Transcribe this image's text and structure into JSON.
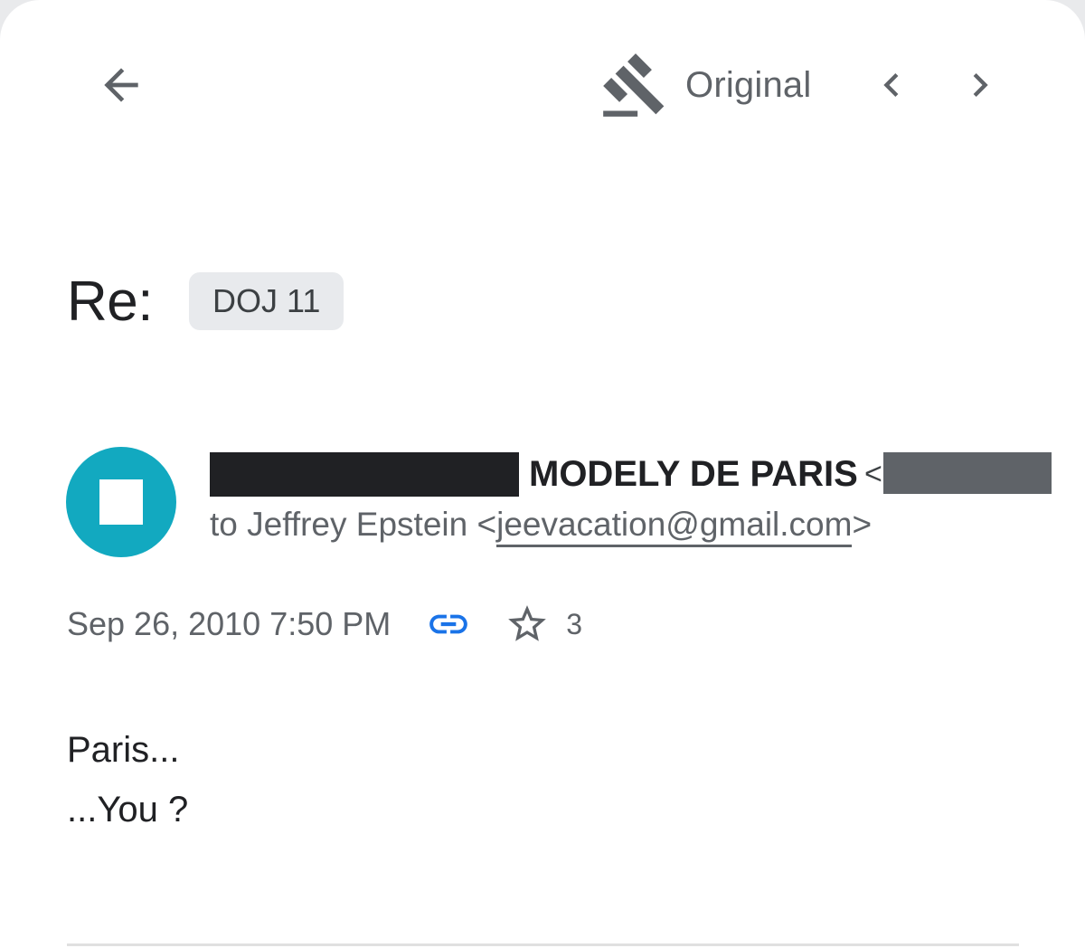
{
  "toolbar": {
    "back_icon": "arrow-back-icon",
    "original_icon": "gavel-icon",
    "original_label": "Original",
    "prev_icon": "chevron-left-icon",
    "next_icon": "chevron-right-icon"
  },
  "subject": {
    "text": "Re:",
    "label_chip": "DOJ 11"
  },
  "sender": {
    "avatar_color": "#12a9c0",
    "name": "MODELY DE PARIS",
    "email_open": "<",
    "to_prefix": "to Jeffrey Epstein <",
    "to_email": "jeevacation@gmail.com",
    "to_suffix": ">"
  },
  "meta": {
    "date": "Sep 26, 2010 7:50 PM",
    "link_icon": "link-icon",
    "link_color": "#1a73e8",
    "star_icon": "star-outline-icon",
    "count": "3"
  },
  "body": {
    "lines": [
      "Paris...",
      "...You ?"
    ]
  }
}
